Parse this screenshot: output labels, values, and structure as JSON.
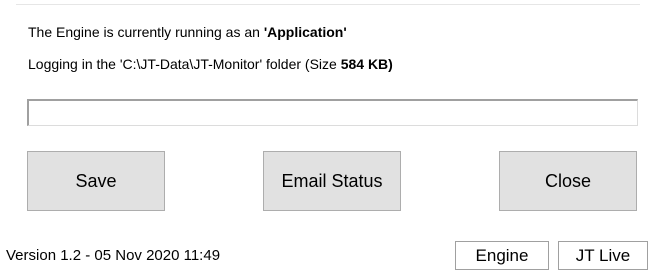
{
  "info": {
    "engine_prefix": "The Engine is currently running as an ",
    "engine_mode": "'Application'",
    "logging_prefix": "Logging in the 'C:\\JT-Data\\JT-Monitor' folder (Size ",
    "logging_size": "584 KB)"
  },
  "buttons": {
    "save_label": "Save",
    "email_label": "Email Status",
    "close_label": "Close"
  },
  "progress": {
    "value": 0
  },
  "status_bar": {
    "version": "Version 1.2 - 05 Nov 2020 11:49",
    "engine_panel": "Engine",
    "jtlive_panel": "JT Live"
  }
}
